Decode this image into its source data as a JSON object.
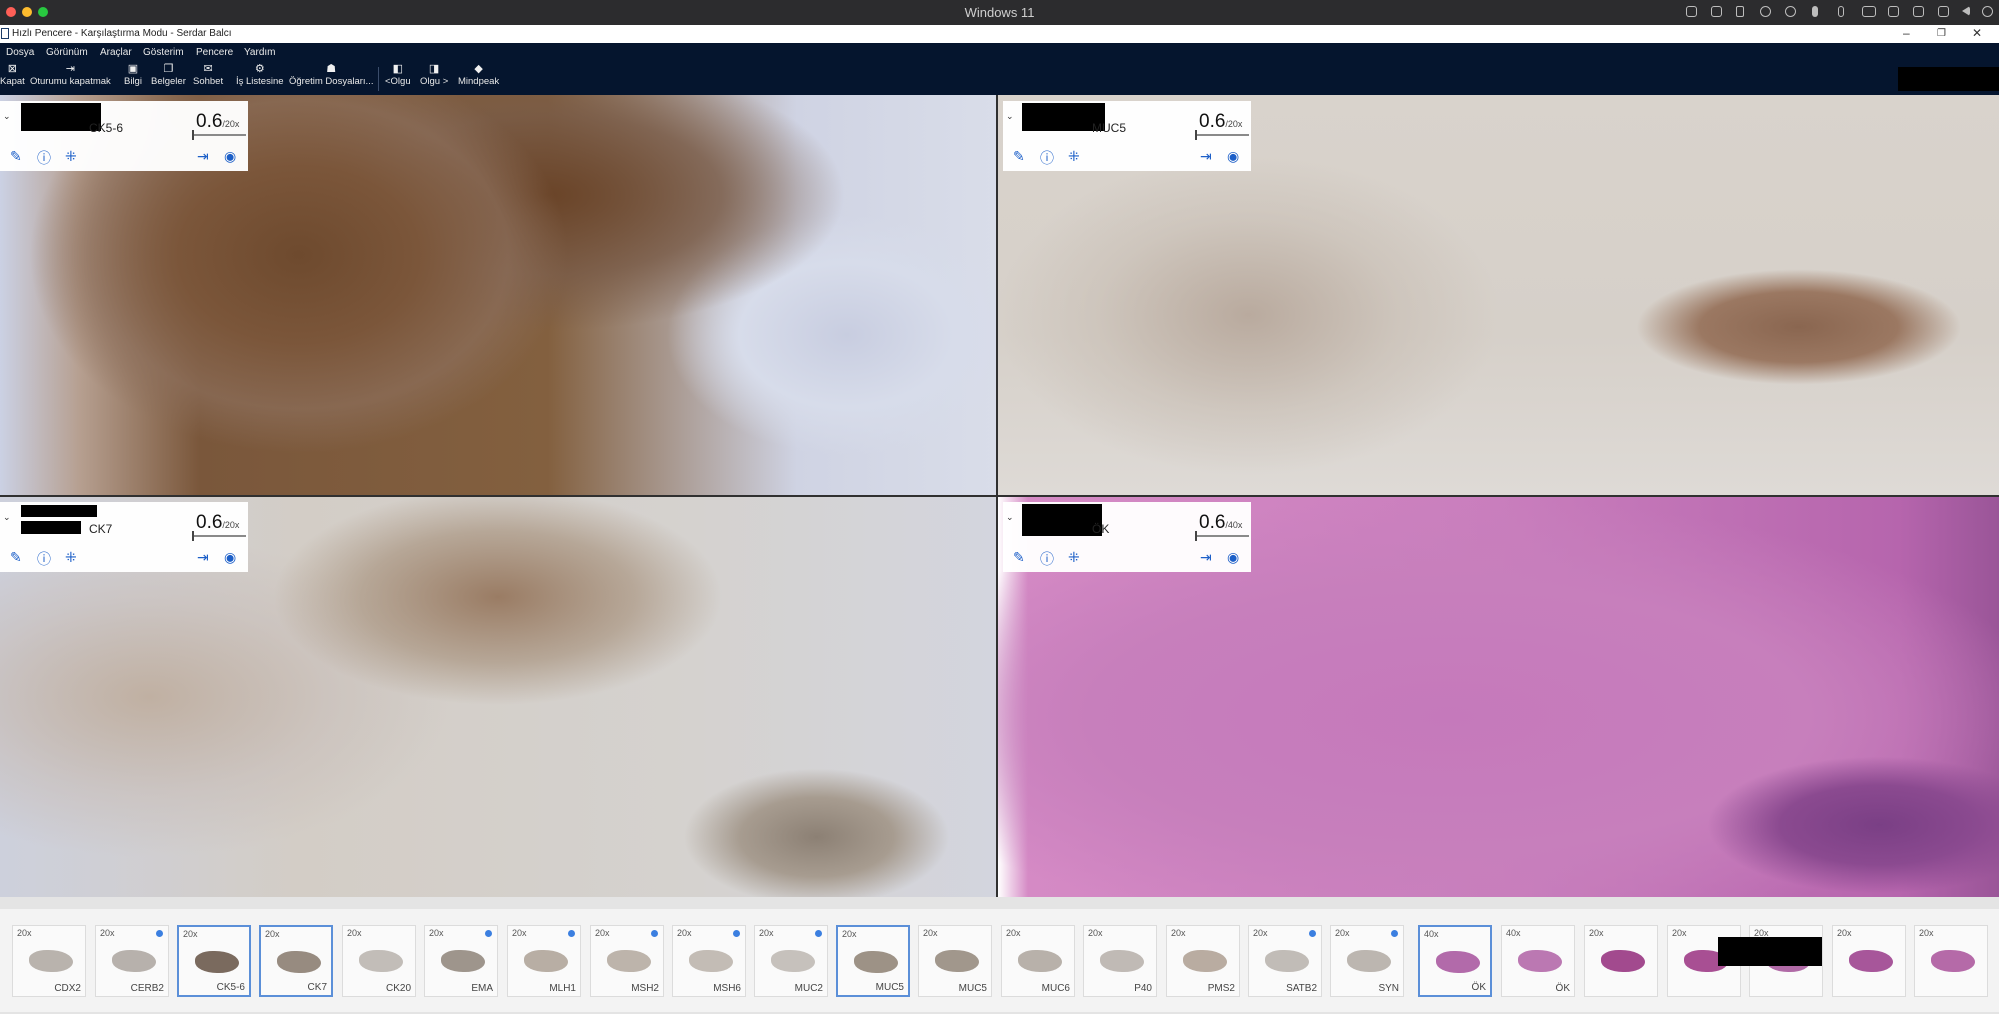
{
  "os": {
    "title": "Windows 11"
  },
  "window": {
    "title": "Hızlı Pencere - Karşılaştırma Modu - Serdar Balcı"
  },
  "menu": [
    "Dosya",
    "Görünüm",
    "Araçlar",
    "Gösterim",
    "Pencere",
    "Yardım"
  ],
  "toolbar": [
    {
      "label": "Kapat",
      "icon": "close-icon"
    },
    {
      "label": "Oturumu kapatmak",
      "icon": "logout-icon"
    },
    {
      "label": "Bilgi",
      "icon": "info-icon"
    },
    {
      "label": "Belgeler",
      "icon": "documents-icon"
    },
    {
      "label": "Sohbet",
      "icon": "chat-icon"
    },
    {
      "label": "İş Listesine",
      "icon": "worklist-icon"
    },
    {
      "label": "Öğretim Dosyaları...",
      "icon": "teaching-files-icon"
    },
    {
      "label": "<Olgu",
      "icon": "previous-case-icon"
    },
    {
      "label": "Olgu >",
      "icon": "next-case-icon"
    },
    {
      "label": "Mindpeak",
      "icon": "mindpeak-icon"
    }
  ],
  "panes": [
    {
      "stain": "CK5-6",
      "zoom": "0.6",
      "max": "/20x"
    },
    {
      "stain": "MUC5",
      "zoom": "0.6",
      "max": "/20x"
    },
    {
      "stain": "CK7",
      "zoom": "0.6",
      "max": "/20x"
    },
    {
      "stain": "ÖK",
      "zoom": "0.6",
      "max": "/40x"
    }
  ],
  "thumbnails": [
    {
      "mag": "20x",
      "label": "CDX2",
      "dot": false,
      "selected": false,
      "color": "#b9b3ad"
    },
    {
      "mag": "20x",
      "label": "CERB2",
      "dot": true,
      "selected": false,
      "color": "#b7b1ac"
    },
    {
      "mag": "20x",
      "label": "CK5-6",
      "dot": false,
      "selected": true,
      "color": "#7a6a5e"
    },
    {
      "mag": "20x",
      "label": "CK7",
      "dot": false,
      "selected": true,
      "color": "#978b80"
    },
    {
      "mag": "20x",
      "label": "CK20",
      "dot": false,
      "selected": false,
      "color": "#c2bdb8"
    },
    {
      "mag": "20x",
      "label": "EMA",
      "dot": true,
      "selected": false,
      "color": "#9e958c"
    },
    {
      "mag": "20x",
      "label": "MLH1",
      "dot": true,
      "selected": false,
      "color": "#b8aea4"
    },
    {
      "mag": "20x",
      "label": "MSH2",
      "dot": true,
      "selected": false,
      "color": "#bdb4ab"
    },
    {
      "mag": "20x",
      "label": "MSH6",
      "dot": true,
      "selected": false,
      "color": "#c3bcb5"
    },
    {
      "mag": "20x",
      "label": "MUC2",
      "dot": true,
      "selected": false,
      "color": "#c6c1bc"
    },
    {
      "mag": "20x",
      "label": "MUC5",
      "dot": false,
      "selected": true,
      "color": "#9d9286"
    },
    {
      "mag": "20x",
      "label": "MUC5",
      "dot": false,
      "selected": false,
      "color": "#a1978c"
    },
    {
      "mag": "20x",
      "label": "MUC6",
      "dot": false,
      "selected": false,
      "color": "#b8b1aa"
    },
    {
      "mag": "20x",
      "label": "P40",
      "dot": false,
      "selected": false,
      "color": "#c0bab5"
    },
    {
      "mag": "20x",
      "label": "PMS2",
      "dot": false,
      "selected": false,
      "color": "#b9aca1"
    },
    {
      "mag": "20x",
      "label": "SATB2",
      "dot": true,
      "selected": false,
      "color": "#c1bcb7"
    },
    {
      "mag": "20x",
      "label": "SYN",
      "dot": true,
      "selected": false,
      "color": "#bcb6b0"
    },
    {
      "mag": "40x",
      "label": "ÖK",
      "dot": false,
      "selected": true,
      "color": "#b26aaa"
    },
    {
      "mag": "40x",
      "label": "ÖK",
      "dot": false,
      "selected": false,
      "color": "#bb78b2"
    },
    {
      "mag": "20x",
      "label": "",
      "dot": false,
      "selected": false,
      "color": "#a24a8e"
    },
    {
      "mag": "20x",
      "label": "",
      "dot": false,
      "selected": false,
      "color": "#a84f93"
    },
    {
      "mag": "20x",
      "label": "",
      "dot": false,
      "selected": false,
      "color": "#b06aa6"
    },
    {
      "mag": "20x",
      "label": "",
      "dot": false,
      "selected": false,
      "color": "#a7569a"
    },
    {
      "mag": "20x",
      "label": "",
      "dot": false,
      "selected": false,
      "color": "#b56aa8"
    }
  ]
}
